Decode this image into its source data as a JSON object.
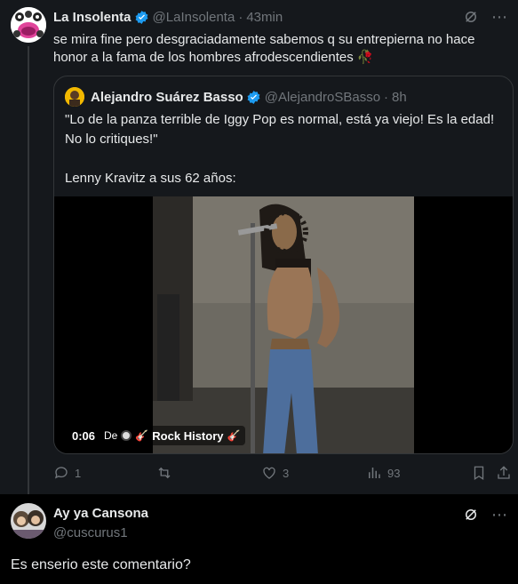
{
  "post": {
    "author_name": "La Insolenta",
    "author_handle": "@LaInsolenta",
    "separator": "·",
    "time": "43min",
    "text": "se mira fine pero desgraciadamente sabemos q su entrepierna no hace honor a la fama de los hombres afrodescendientes 🥀",
    "quote": {
      "author_name": "Alejandro Suárez Basso",
      "author_handle": "@AlejandroSBasso",
      "separator": "·",
      "time": "8h",
      "text_line1": "\"Lo de la panza terrible de Iggy Pop es normal, está ya viejo! Es la edad! No lo critiques!\"",
      "text_line2": "Lenny Kravitz a sus 62 años:",
      "video": {
        "duration": "0:06",
        "source_prefix": "De",
        "source_name": "Rock History",
        "source_emoji": "🎸"
      }
    },
    "actions": {
      "replies": "1",
      "reposts": "",
      "likes": "3",
      "views": "93"
    }
  },
  "reply": {
    "author_name": "Ay ya Cansona",
    "author_handle": "@cuscurus1",
    "text": "Es enserio este comentario?"
  },
  "colors": {
    "background": "#000000",
    "post_background": "#15181c",
    "text": "#e7e9ea",
    "muted": "#71767b",
    "verified": "#1d9bf0",
    "border": "#333639"
  },
  "icons": {
    "grok": "grok-icon",
    "more": "more-icon",
    "verified": "verified-badge-icon",
    "reply": "reply-icon",
    "repost": "repost-icon",
    "like": "like-icon",
    "views": "views-icon",
    "bookmark": "bookmark-icon",
    "share": "share-icon"
  }
}
